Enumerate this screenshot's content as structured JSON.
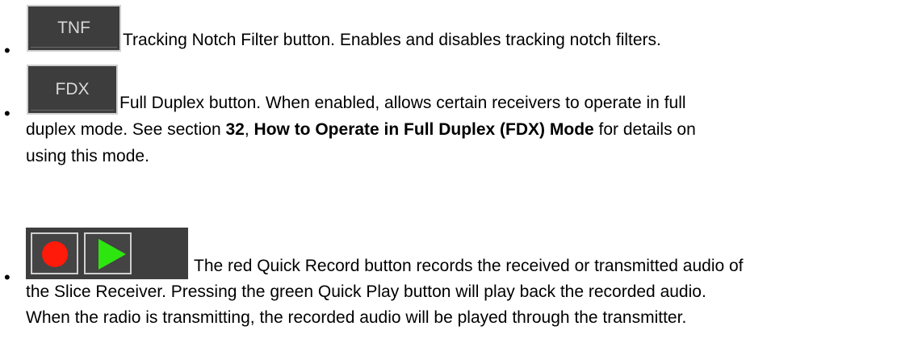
{
  "items": [
    {
      "button_label": "TNF",
      "text": "Tracking Notch Filter button.  Enables and disables tracking notch filters."
    },
    {
      "button_label": "FDX",
      "line1": "Full Duplex button.  When enabled, allows certain receivers to operate in full",
      "line2_a": "duplex mode.  See section ",
      "line2_b": "32",
      "line2_c": ", ",
      "line2_d": "How to Operate in Full Duplex (FDX) Mode",
      "line2_e": " for details on",
      "line3": "using this mode."
    },
    {
      "record_icon": "record-icon",
      "play_icon": "play-icon",
      "record_color": "#ff1a0a",
      "play_color": "#2ee60f",
      "line1": "The red Quick Record button records the received or transmitted audio of",
      "line2": "the Slice Receiver.  Pressing the green Quick Play button will play back the recorded audio.",
      "line3": "When the radio is transmitting, the recorded audio will be played through the transmitter."
    }
  ]
}
